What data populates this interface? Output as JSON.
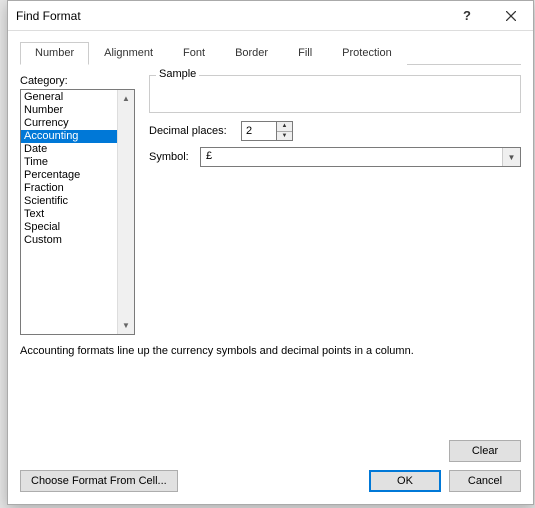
{
  "window": {
    "title": "Find Format",
    "help": "?",
    "close": "×"
  },
  "tabs": {
    "items": [
      {
        "label": "Number",
        "active": true
      },
      {
        "label": "Alignment"
      },
      {
        "label": "Font"
      },
      {
        "label": "Border"
      },
      {
        "label": "Fill"
      },
      {
        "label": "Protection"
      }
    ]
  },
  "category": {
    "label": "Category:",
    "items": [
      "General",
      "Number",
      "Currency",
      "Accounting",
      "Date",
      "Time",
      "Percentage",
      "Fraction",
      "Scientific",
      "Text",
      "Special",
      "Custom"
    ],
    "selected": "Accounting"
  },
  "sample": {
    "legend": "Sample",
    "value": ""
  },
  "decimal": {
    "label": "Decimal places:",
    "value": "2"
  },
  "symbol": {
    "label": "Symbol:",
    "value": "£"
  },
  "description": "Accounting formats line up the currency symbols and decimal points in a column.",
  "buttons": {
    "clear": "Clear",
    "choose": "Choose Format From Cell...",
    "ok": "OK",
    "cancel": "Cancel"
  }
}
